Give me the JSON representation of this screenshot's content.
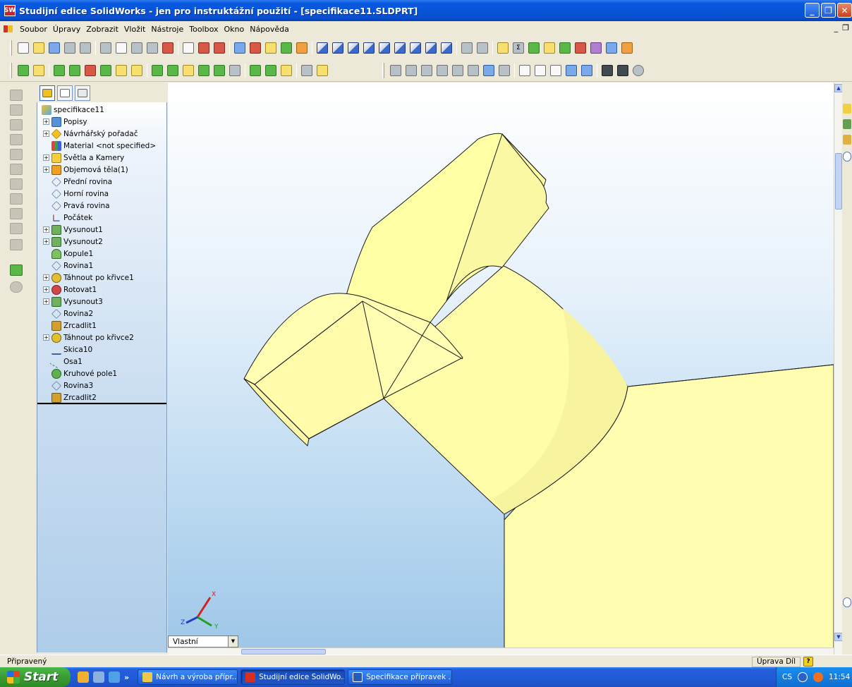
{
  "window": {
    "title": "Studijní edice SolidWorks - jen pro instruktážní použití - [specifikace11.SLDPRT]",
    "app_icon_label": "SW"
  },
  "menu": {
    "items": [
      "Soubor",
      "Úpravy",
      "Zobrazit",
      "Vložit",
      "Nástroje",
      "Toolbox",
      "Okno",
      "Nápověda"
    ]
  },
  "feature_tree": {
    "root": "specifikace11",
    "items": [
      {
        "label": "Popisy",
        "icon": "annotations-icon",
        "expandable": true
      },
      {
        "label": "Návrhářský pořadač",
        "icon": "design-binder-icon",
        "expandable": true
      },
      {
        "label": "Material <not specified>",
        "icon": "material-icon",
        "expandable": false
      },
      {
        "label": "Světla a Kamery",
        "icon": "lights-cameras-icon",
        "expandable": true
      },
      {
        "label": "Objemová těla(1)",
        "icon": "solid-bodies-icon",
        "expandable": true
      },
      {
        "label": "Přední rovina",
        "icon": "plane-icon",
        "expandable": false
      },
      {
        "label": "Horní rovina",
        "icon": "plane-icon",
        "expandable": false
      },
      {
        "label": "Pravá rovina",
        "icon": "plane-icon",
        "expandable": false
      },
      {
        "label": "Počátek",
        "icon": "origin-icon",
        "expandable": false
      },
      {
        "label": "Vysunout1",
        "icon": "extrude-icon",
        "expandable": true
      },
      {
        "label": "Vysunout2",
        "icon": "extrude-icon",
        "expandable": true
      },
      {
        "label": "Kopule1",
        "icon": "dome-icon",
        "expandable": false
      },
      {
        "label": "Rovina1",
        "icon": "plane-icon",
        "expandable": false
      },
      {
        "label": "Táhnout po křivce1",
        "icon": "sweep-icon",
        "expandable": true
      },
      {
        "label": "Rotovat1",
        "icon": "revolve-icon",
        "expandable": true
      },
      {
        "label": "Vysunout3",
        "icon": "extrude-icon",
        "expandable": true
      },
      {
        "label": "Rovina2",
        "icon": "plane-icon",
        "expandable": false
      },
      {
        "label": "Zrcadlit1",
        "icon": "mirror-icon",
        "expandable": false
      },
      {
        "label": "Táhnout po křivce2",
        "icon": "sweep-icon",
        "expandable": true
      },
      {
        "label": "Skica10",
        "icon": "sketch-icon",
        "expandable": false
      },
      {
        "label": "Osa1",
        "icon": "axis-icon",
        "expandable": false
      },
      {
        "label": "Kruhové pole1",
        "icon": "circular-pattern-icon",
        "expandable": false
      },
      {
        "label": "Rovina3",
        "icon": "plane-icon",
        "expandable": false
      },
      {
        "label": "Zrcadlit2",
        "icon": "mirror-icon",
        "expandable": false
      }
    ]
  },
  "viewport": {
    "view_selector": "Vlastní",
    "triad": {
      "x": "X",
      "y": "Y",
      "z": "Z"
    },
    "model_color": "#ffffa8",
    "edge_color": "#1a1a1a"
  },
  "status": {
    "text": "Připravený",
    "mode": "Úprava Díl",
    "help": "?"
  },
  "taskbar": {
    "start": "Start",
    "more": "»",
    "tasks": [
      {
        "label": "Návrh a výroba přípr...",
        "icon": "folder-icon",
        "active": false
      },
      {
        "label": "Studijní edice SolidWo...",
        "icon": "solidworks-icon",
        "active": true
      },
      {
        "label": "Specifikace přípravek ...",
        "icon": "word-icon",
        "active": false
      }
    ],
    "tray": {
      "lang": "CS",
      "time": "11:54"
    }
  }
}
